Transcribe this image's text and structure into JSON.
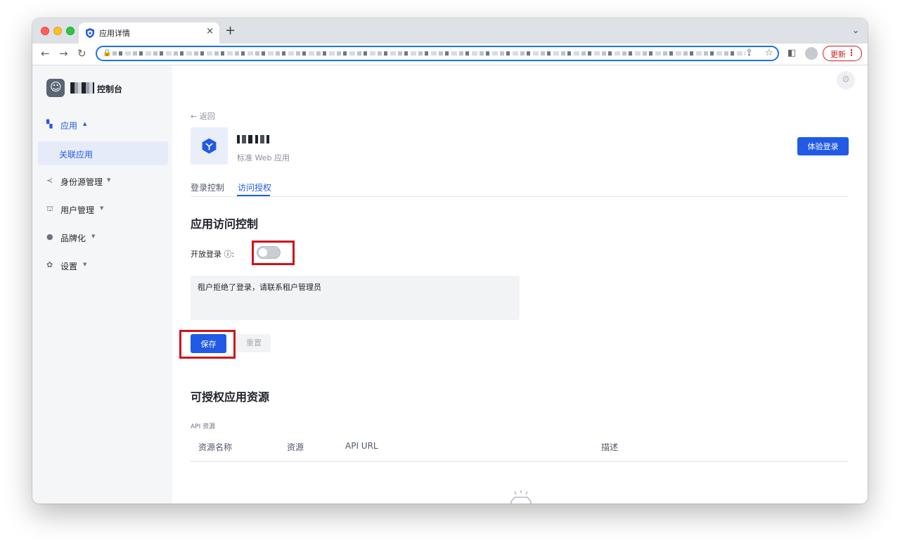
{
  "browser": {
    "tab_title": "应用详情",
    "tab_close": "×",
    "new_tab": "+",
    "tabs_menu": "⌄",
    "update_label": "更新",
    "update_menu": "⋮"
  },
  "sidebar": {
    "console_title": "控制台",
    "items": [
      {
        "label": "应用",
        "icon": "apps-icon",
        "expanded": true
      },
      {
        "label": "身份源管理",
        "icon": "share-icon"
      },
      {
        "label": "用户管理",
        "icon": "org-icon"
      },
      {
        "label": "品牌化",
        "icon": "brush-icon"
      },
      {
        "label": "设置",
        "icon": "gear-icon"
      }
    ],
    "subitem_active": "关联应用"
  },
  "main": {
    "back_label": "← 返回",
    "app_type": "标准 Web 应用",
    "try_login_button": "体验登录",
    "tabs": [
      {
        "label": "登录控制"
      },
      {
        "label": "访问授权",
        "active": true
      }
    ],
    "access_control": {
      "title": "应用访问控制",
      "open_login_label": "开放登录 ⓘ:",
      "open_login_enabled": false,
      "message_value": "租户拒绝了登录，请联系租户管理员",
      "save_button": "保存",
      "reset_button": "重置"
    },
    "resources": {
      "title": "可授权应用资源",
      "caption": "API 资源",
      "columns": [
        "资源名称",
        "资源",
        "API URL",
        "描述"
      ]
    }
  },
  "colors": {
    "primary": "#215ae5",
    "highlight": "#d0121b",
    "sidebar_bg": "#f5f6f8"
  }
}
